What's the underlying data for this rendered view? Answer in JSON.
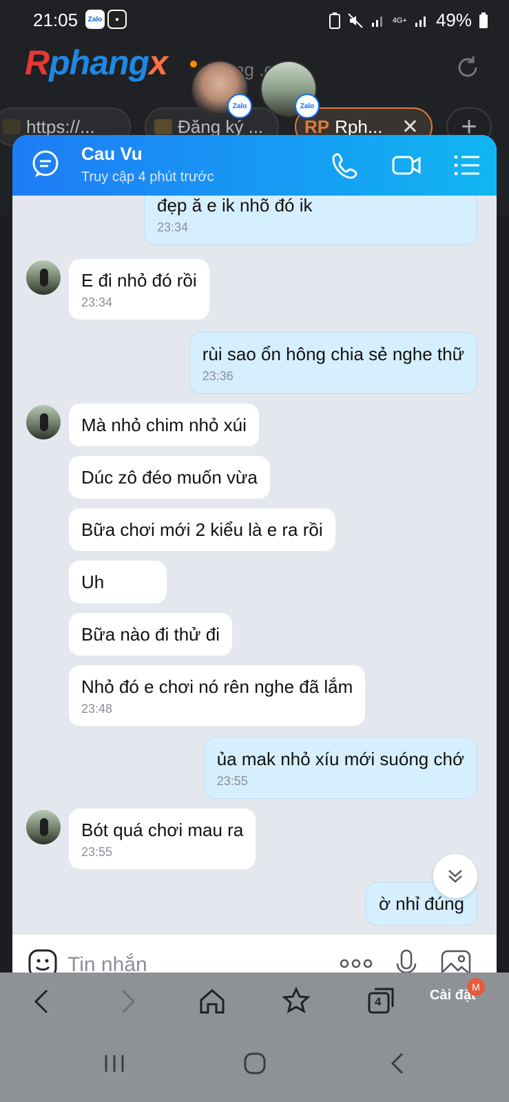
{
  "status_bar": {
    "time": "21:05",
    "battery": "49%",
    "network": "4G+",
    "app_icons": [
      "Zalo",
      "app"
    ]
  },
  "browser": {
    "brand": {
      "r": "R",
      "p": "phang",
      "x": "x"
    },
    "url_fragment": "ng .com",
    "tabs": [
      {
        "label": "https://..."
      },
      {
        "label": "Đăng ký ..."
      },
      {
        "label": "Rph..."
      }
    ],
    "tab_prefix_rp": "RP",
    "settings_label": "Cài đặt",
    "tab_count": "4",
    "badge": "M"
  },
  "chat": {
    "contact_name": "Cau Vu",
    "contact_status": "Truy cập 4 phút trước",
    "input_placeholder": "Tin nhắn",
    "messages": [
      {
        "dir": "out",
        "text": "đẹp ă e ik nhõ đó ik",
        "time": "23:34"
      },
      {
        "dir": "in",
        "text": "E đi nhỏ đó rồi",
        "time": "23:34"
      },
      {
        "dir": "out",
        "text": "rùi sao ổn hông chia sẻ nghe thữ",
        "time": "23:36"
      },
      {
        "dir": "in",
        "text": "Mà nhỏ chim nhỏ xúi",
        "time": ""
      },
      {
        "dir": "in",
        "text": "Dúc zô đéo muốn vừa",
        "time": ""
      },
      {
        "dir": "in",
        "text": "Bữa chơi mới 2 kiểu là e ra rồi",
        "time": ""
      },
      {
        "dir": "in",
        "text": "Uh",
        "time": ""
      },
      {
        "dir": "in",
        "text": "Bữa nào đi thử đi",
        "time": ""
      },
      {
        "dir": "in",
        "text": "Nhỏ đó e chơi nó rên nghe đã lắm",
        "time": "23:48"
      },
      {
        "dir": "out",
        "text": "ủa mak nhỏ xíu mới suóng chớ",
        "time": "23:55"
      },
      {
        "dir": "in",
        "text": "Bót quá chơi mau ra",
        "time": "23:55"
      },
      {
        "dir": "out",
        "text": "ờ nhỉ đúng",
        "time": ""
      }
    ]
  },
  "colors": {
    "header_start": "#1e7cf5",
    "header_end": "#12b6f2",
    "outgoing_bubble": "#d6efff",
    "incoming_bubble": "#ffffff",
    "chat_background": "#e4e8ee",
    "brand_red": "#e53935",
    "brand_blue": "#1e88e5",
    "accent_orange": "#ff8a00"
  },
  "icons": {
    "header": [
      "chat-bubble-icon",
      "phone-icon",
      "video-camera-icon",
      "list-menu-icon"
    ],
    "composer": [
      "emoji-icon",
      "more-dots-icon",
      "microphone-icon",
      "image-icon"
    ],
    "browser": [
      "back-icon",
      "forward-icon",
      "home-icon",
      "bookmark-star-icon",
      "tabs-icon"
    ],
    "system_nav": [
      "recents-icon",
      "home-circle-icon",
      "back-chevron-icon"
    ]
  }
}
